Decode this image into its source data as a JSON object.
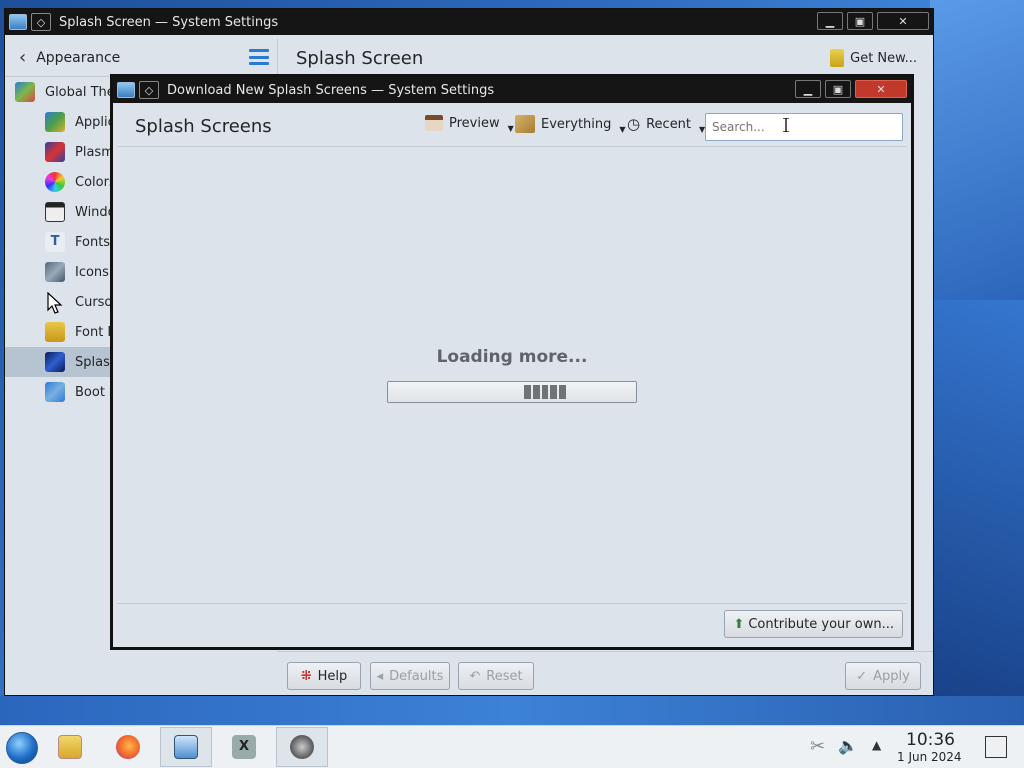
{
  "main_window": {
    "title": "Splash Screen — System Settings",
    "sidebar_header": "Appearance",
    "sidebar_items": [
      {
        "label": "Global Theme",
        "selected": false
      },
      {
        "label": "Application Style",
        "selected": false
      },
      {
        "label": "Plasma Style",
        "selected": false
      },
      {
        "label": "Colors",
        "selected": false
      },
      {
        "label": "Window Decorations",
        "selected": false
      },
      {
        "label": "Fonts",
        "selected": false
      },
      {
        "label": "Icons",
        "selected": false
      },
      {
        "label": "Cursors",
        "selected": false
      },
      {
        "label": "Font Management",
        "selected": false
      },
      {
        "label": "Splash Screen",
        "selected": true
      },
      {
        "label": "Boot Splash Screen",
        "selected": false
      }
    ],
    "content_title": "Splash Screen",
    "get_new_label": "Get New...",
    "buttons": {
      "help": "Help",
      "defaults": "Defaults",
      "reset": "Reset",
      "apply": "Apply"
    }
  },
  "dialog": {
    "title": "Download New Splash Screens — System Settings",
    "heading": "Splash Screens",
    "toolbar": {
      "preview": "Preview",
      "everything": "Everything",
      "recent": "Recent"
    },
    "search_placeholder": "Search...",
    "loading_text": "Loading more...",
    "contribute_label": "Contribute your own..."
  },
  "taskbar": {
    "time": "10:36",
    "date": "1 Jun 2024"
  },
  "colors": {
    "selection": "#b6c3d1",
    "accent": "#2a7ad0",
    "titlebar": "#151515"
  }
}
